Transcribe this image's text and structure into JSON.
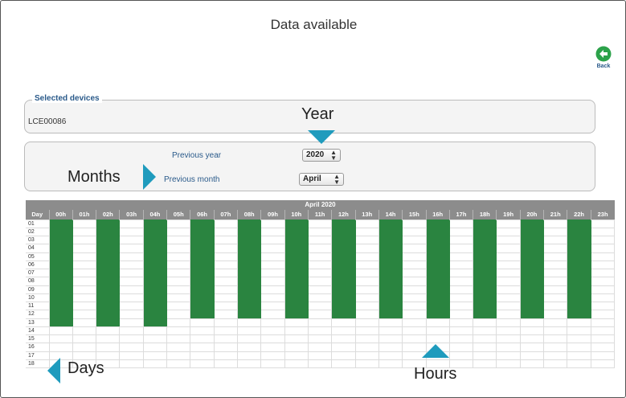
{
  "page": {
    "title": "Data available"
  },
  "back": {
    "label": "Back",
    "icon": "back-arrow-icon",
    "color": "#2ca24a"
  },
  "devices": {
    "legend": "Selected devices",
    "items": [
      "LCE00086"
    ]
  },
  "filters": {
    "year_label": "Previous year",
    "year_value": "2020",
    "month_label": "Previous month",
    "month_value": "April"
  },
  "callouts": {
    "year": "Year",
    "months": "Months",
    "days": "Days",
    "hours": "Hours",
    "color": "#1f9bbd"
  },
  "grid": {
    "title": "April 2020",
    "day_header": "Day",
    "hours": [
      "00h",
      "01h",
      "02h",
      "03h",
      "04h",
      "05h",
      "06h",
      "07h",
      "08h",
      "09h",
      "10h",
      "11h",
      "12h",
      "13h",
      "14h",
      "15h",
      "16h",
      "17h",
      "18h",
      "19h",
      "20h",
      "21h",
      "22h",
      "23h"
    ],
    "days": [
      "01",
      "02",
      "03",
      "04",
      "05",
      "06",
      "07",
      "08",
      "09",
      "10",
      "11",
      "12",
      "13",
      "14",
      "15",
      "16",
      "17",
      "18"
    ],
    "available_color": "#2a8440",
    "available": {
      "00h": {
        "first_day": 1,
        "last_day": 13
      },
      "02h": {
        "first_day": 1,
        "last_day": 13
      },
      "04h": {
        "first_day": 1,
        "last_day": 13
      },
      "06h": {
        "first_day": 1,
        "last_day": 12
      },
      "08h": {
        "first_day": 1,
        "last_day": 12
      },
      "10h": {
        "first_day": 1,
        "last_day": 12
      },
      "12h": {
        "first_day": 1,
        "last_day": 12
      },
      "14h": {
        "first_day": 1,
        "last_day": 12
      },
      "16h": {
        "first_day": 1,
        "last_day": 12
      },
      "18h": {
        "first_day": 1,
        "last_day": 12
      },
      "20h": {
        "first_day": 1,
        "last_day": 12
      },
      "22h": {
        "first_day": 1,
        "last_day": 12
      }
    }
  }
}
